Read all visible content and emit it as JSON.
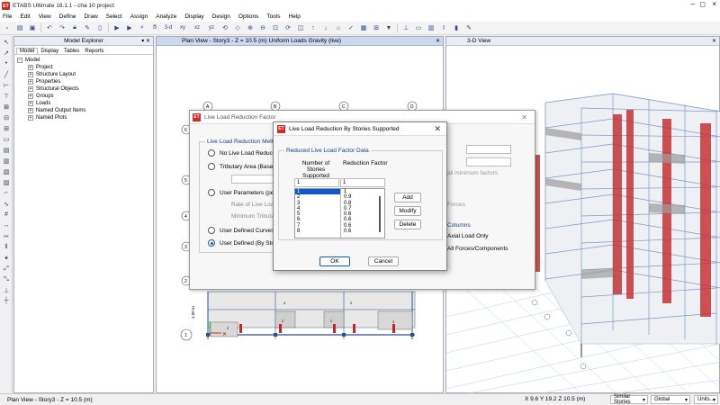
{
  "app": {
    "title": "ETABS Ultimate 18.1.1 - cha 10 project",
    "logo_text": "ET",
    "accent_color": "#0e59c4",
    "logo_color": "#d6281e"
  },
  "menu": [
    "File",
    "Edit",
    "View",
    "Define",
    "Draw",
    "Select",
    "Assign",
    "Analyze",
    "Display",
    "Design",
    "Options",
    "Tools",
    "Help"
  ],
  "toolbar": {
    "icons": [
      "new-icon",
      "open-icon",
      "save-icon",
      "undo-icon",
      "redo-icon",
      "lock-icon",
      "pencil-icon",
      "trash-icon",
      "run-icon",
      "lock-run-icon",
      "zoom-icon",
      "pan-icon",
      "3d-view-icon",
      "plan-view-icon",
      "elevation-icon",
      "rotate-icon",
      "perspective-icon",
      "zoom-in-icon",
      "zoom-out-icon",
      "zoom-window-icon",
      "refresh-icon",
      "display-icon",
      "assign-icon",
      "section-icon",
      "frame-icon",
      "wall-icon",
      "shell-icon",
      "load-icon"
    ],
    "view_label": "3-d",
    "xy_label": "xy",
    "xz_label": "xz",
    "yz_label": "yz"
  },
  "explorer": {
    "title": "Model Explorer",
    "tabs": [
      "Model",
      "Display",
      "Tables",
      "Reports"
    ],
    "root": "Model",
    "items": [
      "Project",
      "Structure Layout",
      "Properties",
      "Structural Objects",
      "Groups",
      "Loads",
      "Named Output Items",
      "Named Plots"
    ]
  },
  "plan_view": {
    "title": "Plan View - Story3 - Z = 10.5 (m)  Uniform Loads Gravity  (live)",
    "grid_letters": [
      "A",
      "B",
      "C",
      "D"
    ],
    "grid_numbers": [
      "1",
      "2",
      "3",
      "4",
      "5",
      "6"
    ],
    "dim_label": "4.00 m",
    "load_labels": [
      "2",
      "3",
      "2",
      "3",
      "2",
      "2",
      "2"
    ]
  },
  "view_3d": {
    "title": "3-D View"
  },
  "dialog_back": {
    "title": "Live Load Reduction Factor",
    "method_group": "Live Load Reduction Method",
    "options": [
      "No Live Load Reduction",
      "Tributary Area (Based on",
      "User Parameters (per Se",
      "User Defined Curves (By",
      "User Defined (By Stories"
    ],
    "rate_label": "Rate of Live Load",
    "min_label": "Minimum Tributary",
    "min_factor_label": "all minimum factors",
    "forces_label": "Forces",
    "columns_label": "Columns",
    "axial_option": "Axial Load Only",
    "all_option": "All Forces/Components"
  },
  "dialog_front": {
    "title": "Live Load Reduction By Stories Supported",
    "group_label": "Reduced Live Load Factor Data",
    "col1_header": "Number of Stories Supported",
    "col2_header": "Reduction  Factor",
    "input_stories": "1",
    "input_factor": "1",
    "stories": [
      "1",
      "2",
      "3",
      "4",
      "5",
      "6",
      "7",
      "8"
    ],
    "factors": [
      "1",
      "0.9",
      "0.8",
      "0.7",
      "0.6",
      "0.6",
      "0.6",
      "0.6"
    ],
    "add_label": "Add",
    "modify_label": "Modify",
    "delete_label": "Delete",
    "ok_label": "OK",
    "cancel_label": "Cancel"
  },
  "status": {
    "left": "Plan View - Story3 - Z = 10.5 (m)",
    "coords": "X 9.6  Y 19.2  Z 10.5 (m)",
    "similar": "Similar Stories",
    "global": "Global",
    "units": "Units..."
  }
}
